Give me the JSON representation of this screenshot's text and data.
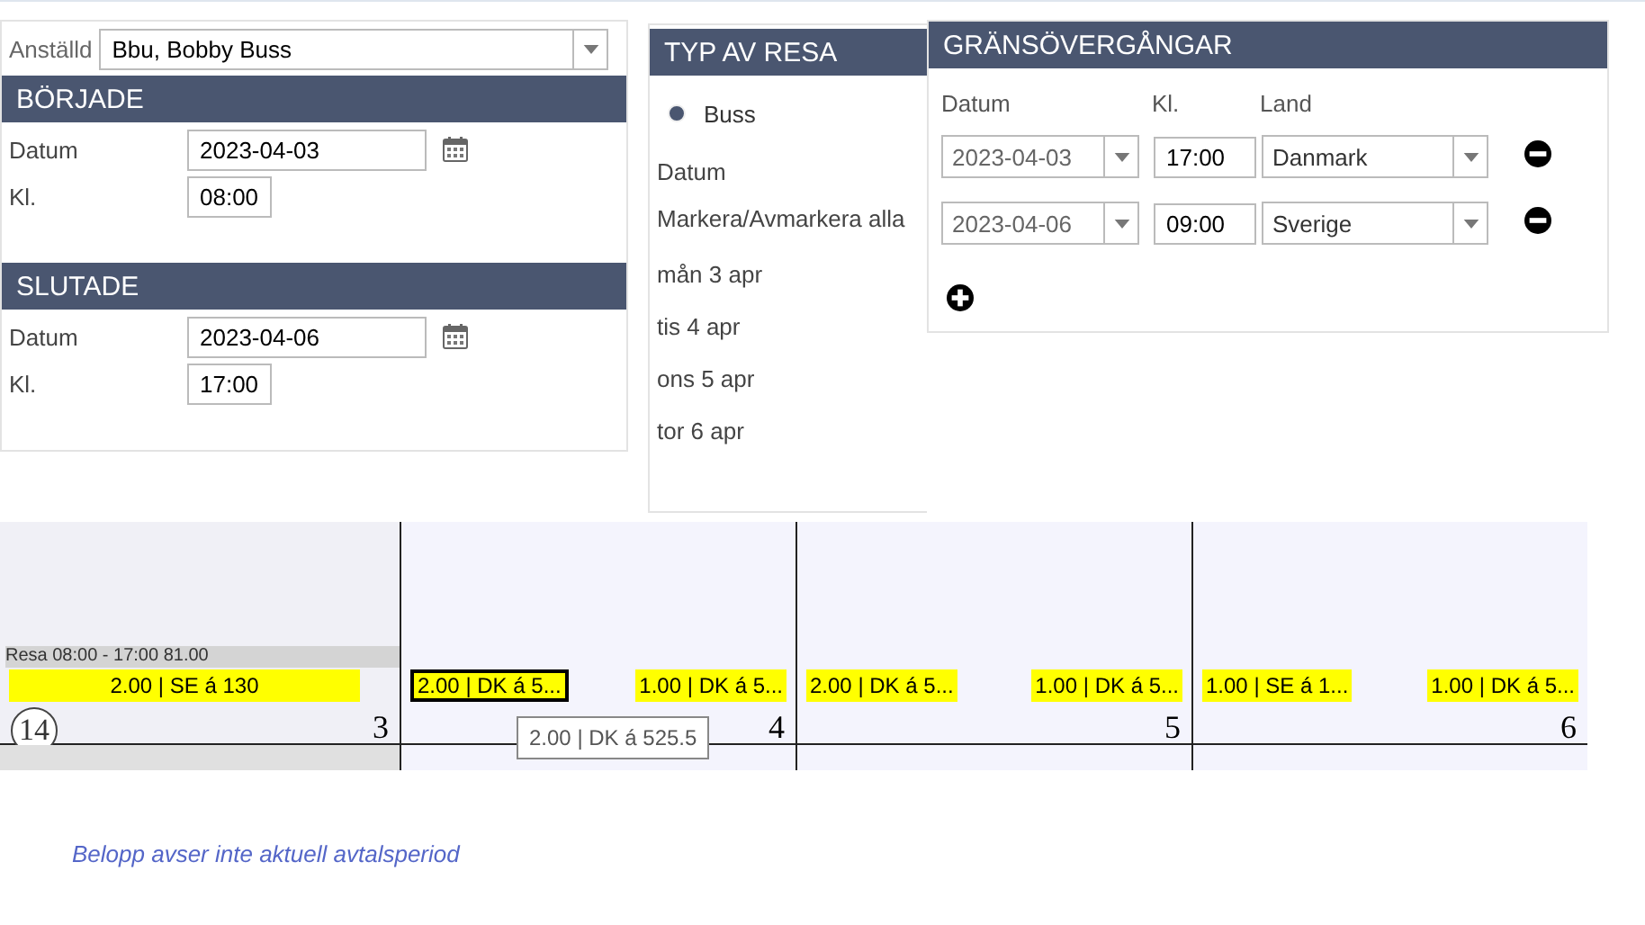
{
  "employee": {
    "label": "Anställd",
    "value": "Bbu, Bobby Buss"
  },
  "started": {
    "title": "BÖRJADE",
    "date_label": "Datum",
    "date": "2023-04-03",
    "time_label": "Kl.",
    "time": "08:00"
  },
  "ended": {
    "title": "SLUTADE",
    "date_label": "Datum",
    "date": "2023-04-06",
    "time_label": "Kl.",
    "time": "17:00"
  },
  "trip_type": {
    "title": "TYP AV RESA",
    "options": [
      {
        "label": "Buss",
        "selected": true
      }
    ],
    "date_header": "Datum",
    "toggle_all": "Markera/Avmarkera alla",
    "days": [
      "mån 3 apr",
      "tis 4 apr",
      "ons 5 apr",
      "tor 6 apr"
    ]
  },
  "border_crossings": {
    "title": "GRÄNSÖVERGÅNGAR",
    "columns": [
      "Datum",
      "Kl.",
      "Land"
    ],
    "rows": [
      {
        "date": "2023-04-03",
        "time": "17:00",
        "country": "Danmark"
      },
      {
        "date": "2023-04-06",
        "time": "09:00",
        "country": "Sverige"
      }
    ]
  },
  "calendar": {
    "week": "14",
    "trip": "Resa 08:00 - 17:00 81.00",
    "days": [
      {
        "number": "3",
        "chips": [
          {
            "text": "2.00 | SE á 130",
            "selected": false
          }
        ]
      },
      {
        "number": "4",
        "chips": [
          {
            "text": "2.00 | DK á 5...",
            "selected": true
          },
          {
            "text": "1.00 | DK á 5...",
            "selected": false
          }
        ]
      },
      {
        "number": "5",
        "chips": [
          {
            "text": "2.00 | DK á 5...",
            "selected": false
          },
          {
            "text": "1.00 | DK á 5...",
            "selected": false
          }
        ]
      },
      {
        "number": "6",
        "chips": [
          {
            "text": "1.00 | SE á 1...",
            "selected": false
          },
          {
            "text": "1.00 | DK á 5...",
            "selected": false
          }
        ]
      }
    ],
    "tooltip": "2.00 | DK á 525.5"
  },
  "note": "Belopp avser inte aktuell avtalsperiod"
}
